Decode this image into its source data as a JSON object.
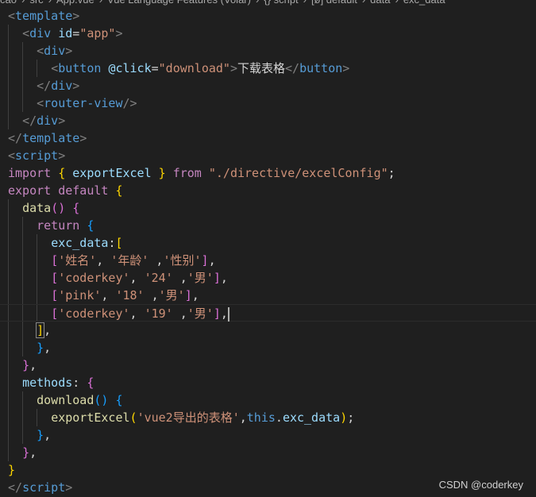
{
  "breadcrumb": [
    "cao",
    "src",
    "App.vue",
    "Vue Language Features (Volar)",
    "{} script",
    "[ø] default",
    "data",
    "exc_data"
  ],
  "current_line": 18,
  "watermark": "CSDN @coderkey",
  "colors": {
    "background": "#1f1f1f",
    "tag": "#569cd6",
    "string": "#ce9178",
    "keyword": "#c586c0",
    "function": "#dcdcaa",
    "bracket1": "#ffd700",
    "bracket2": "#da70d6",
    "bracket3": "#179fff"
  },
  "lines": [
    {
      "indent": 0,
      "tokens": [
        [
          "p",
          "<"
        ],
        [
          "t",
          "template"
        ],
        [
          "p",
          ">"
        ]
      ]
    },
    {
      "indent": 1,
      "tokens": [
        [
          "p",
          "<"
        ],
        [
          "t",
          "div"
        ],
        [
          "w",
          " "
        ],
        [
          "a",
          "id"
        ],
        [
          "w",
          "="
        ],
        [
          "s",
          "\"app\""
        ],
        [
          "p",
          ">"
        ]
      ]
    },
    {
      "indent": 2,
      "tokens": [
        [
          "p",
          "<"
        ],
        [
          "t",
          "div"
        ],
        [
          "p",
          ">"
        ]
      ]
    },
    {
      "indent": 3,
      "tokens": [
        [
          "p",
          "<"
        ],
        [
          "t",
          "button"
        ],
        [
          "w",
          " "
        ],
        [
          "a",
          "@click"
        ],
        [
          "w",
          "="
        ],
        [
          "s",
          "\"download\""
        ],
        [
          "p",
          ">"
        ],
        [
          "w",
          "下载表格"
        ],
        [
          "p",
          "</"
        ],
        [
          "t",
          "button"
        ],
        [
          "p",
          ">"
        ]
      ]
    },
    {
      "indent": 2,
      "tokens": [
        [
          "p",
          "</"
        ],
        [
          "t",
          "div"
        ],
        [
          "p",
          ">"
        ]
      ]
    },
    {
      "indent": 2,
      "tokens": [
        [
          "p",
          "<"
        ],
        [
          "t",
          "router-view"
        ],
        [
          "p",
          "/>"
        ]
      ]
    },
    {
      "indent": 1,
      "tokens": [
        [
          "p",
          "</"
        ],
        [
          "t",
          "div"
        ],
        [
          "p",
          ">"
        ]
      ]
    },
    {
      "indent": 0,
      "tokens": [
        [
          "p",
          "</"
        ],
        [
          "t",
          "template"
        ],
        [
          "p",
          ">"
        ]
      ]
    },
    {
      "indent": 0,
      "tokens": [
        [
          "p",
          "<"
        ],
        [
          "t",
          "script"
        ],
        [
          "p",
          ">"
        ]
      ]
    },
    {
      "indent": 0,
      "tokens": [
        [
          "k",
          "import"
        ],
        [
          "w",
          " "
        ],
        [
          "b1",
          "{"
        ],
        [
          "v",
          " exportExcel "
        ],
        [
          "b1",
          "}"
        ],
        [
          "w",
          " "
        ],
        [
          "k",
          "from"
        ],
        [
          "w",
          " "
        ],
        [
          "s",
          "\"./directive/excelConfig\""
        ],
        [
          "w",
          ";"
        ]
      ]
    },
    {
      "indent": 0,
      "tokens": [
        [
          "k",
          "export default"
        ],
        [
          "w",
          " "
        ],
        [
          "b1",
          "{"
        ]
      ]
    },
    {
      "indent": 1,
      "tokens": [
        [
          "f",
          "data"
        ],
        [
          "b2",
          "()"
        ],
        [
          "w",
          " "
        ],
        [
          "b2",
          "{"
        ]
      ]
    },
    {
      "indent": 2,
      "tokens": [
        [
          "k",
          "return"
        ],
        [
          "w",
          " "
        ],
        [
          "b3",
          "{"
        ]
      ]
    },
    {
      "indent": 3,
      "tokens": [
        [
          "v",
          "exc_data"
        ],
        [
          "w",
          ":"
        ],
        [
          "b1",
          "["
        ]
      ]
    },
    {
      "indent": 3,
      "tokens": [
        [
          "b2",
          "["
        ],
        [
          "s",
          "'姓名'"
        ],
        [
          "w",
          ", "
        ],
        [
          "s",
          "'年龄'"
        ],
        [
          "w",
          " ,"
        ],
        [
          "s",
          "'性别'"
        ],
        [
          "b2",
          "]"
        ],
        [
          "w",
          ","
        ]
      ]
    },
    {
      "indent": 3,
      "tokens": [
        [
          "b2",
          "["
        ],
        [
          "s",
          "'coderkey'"
        ],
        [
          "w",
          ", "
        ],
        [
          "s",
          "'24'"
        ],
        [
          "w",
          " ,"
        ],
        [
          "s",
          "'男'"
        ],
        [
          "b2",
          "]"
        ],
        [
          "w",
          ","
        ]
      ]
    },
    {
      "indent": 3,
      "tokens": [
        [
          "b2",
          "["
        ],
        [
          "s",
          "'pink'"
        ],
        [
          "w",
          ", "
        ],
        [
          "s",
          "'18'"
        ],
        [
          "w",
          " ,"
        ],
        [
          "s",
          "'男'"
        ],
        [
          "b2",
          "]"
        ],
        [
          "w",
          ","
        ]
      ]
    },
    {
      "indent": 3,
      "tokens": [
        [
          "b2",
          "["
        ],
        [
          "s",
          "'coderkey'"
        ],
        [
          "w",
          ", "
        ],
        [
          "s",
          "'19'"
        ],
        [
          "w",
          " ,"
        ],
        [
          "s",
          "'男'"
        ],
        [
          "b2",
          "]"
        ],
        [
          "w",
          ","
        ]
      ]
    },
    {
      "indent": 2,
      "tokens": [
        [
          "b1",
          "]"
        ],
        [
          "w",
          ","
        ]
      ]
    },
    {
      "indent": 2,
      "tokens": [
        [
          "b3",
          "}"
        ],
        [
          "w",
          ","
        ]
      ]
    },
    {
      "indent": 1,
      "tokens": [
        [
          "b2",
          "}"
        ],
        [
          "w",
          ","
        ]
      ]
    },
    {
      "indent": 1,
      "tokens": [
        [
          "v",
          "methods"
        ],
        [
          "w",
          ": "
        ],
        [
          "b2",
          "{"
        ]
      ]
    },
    {
      "indent": 2,
      "tokens": [
        [
          "f",
          "download"
        ],
        [
          "b3",
          "()"
        ],
        [
          "w",
          " "
        ],
        [
          "b3",
          "{"
        ]
      ]
    },
    {
      "indent": 3,
      "tokens": [
        [
          "f",
          "exportExcel"
        ],
        [
          "b1",
          "("
        ],
        [
          "s",
          "'vue2导出的表格'"
        ],
        [
          "w",
          ","
        ],
        [
          "kb",
          "this"
        ],
        [
          "w",
          "."
        ],
        [
          "v",
          "exc_data"
        ],
        [
          "b1",
          ")"
        ],
        [
          "w",
          ";"
        ]
      ]
    },
    {
      "indent": 2,
      "tokens": [
        [
          "b3",
          "}"
        ],
        [
          "w",
          ","
        ]
      ]
    },
    {
      "indent": 1,
      "tokens": [
        [
          "b2",
          "}"
        ],
        [
          "w",
          ","
        ]
      ]
    },
    {
      "indent": 0,
      "tokens": [
        [
          "b1",
          "}"
        ]
      ]
    },
    {
      "indent": 0,
      "tokens": [
        [
          "p",
          "</"
        ],
        [
          "t",
          "script"
        ],
        [
          "p",
          ">"
        ]
      ]
    }
  ]
}
